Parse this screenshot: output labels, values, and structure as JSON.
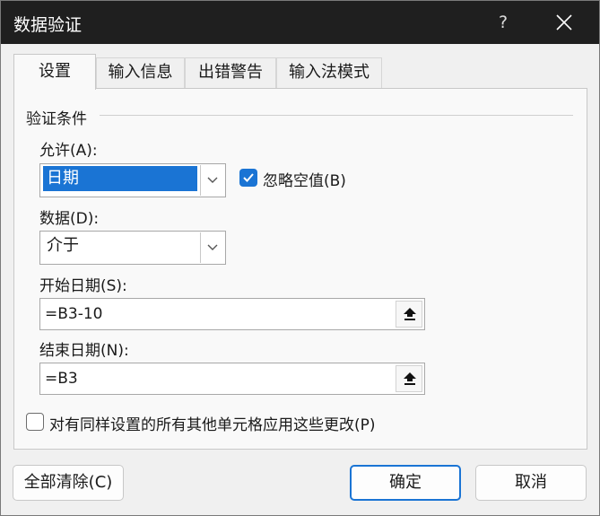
{
  "window": {
    "title": "数据验证",
    "help_glyph": "?"
  },
  "tabs": [
    {
      "label": "设置",
      "active": true
    },
    {
      "label": "输入信息",
      "active": false
    },
    {
      "label": "出错警告",
      "active": false
    },
    {
      "label": "输入法模式",
      "active": false
    }
  ],
  "criteria": {
    "group_label": "验证条件",
    "allow": {
      "label": "允许(A):",
      "value": "日期"
    },
    "ignore_blank": {
      "label": "忽略空值(B)",
      "checked": true
    },
    "data": {
      "label": "数据(D):",
      "value": "介于"
    },
    "start_date": {
      "label": "开始日期(S):",
      "value": "=B3-10"
    },
    "end_date": {
      "label": "结束日期(N):",
      "value": "=B3"
    }
  },
  "apply_all": {
    "label": "对有同样设置的所有其他单元格应用这些更改(P)",
    "checked": false
  },
  "buttons": {
    "clear_all": "全部清除(C)",
    "ok": "确定",
    "cancel": "取消"
  },
  "colors": {
    "accent": "#1a74d4",
    "titlebar": "#1f1f1f",
    "dialog_bg": "#f0f0f0"
  },
  "icons": {
    "close": "close-icon",
    "chevron": "chevron-down-icon",
    "collapse_ref": "collapse-dialog-icon",
    "checkmark": "checkmark-icon"
  }
}
